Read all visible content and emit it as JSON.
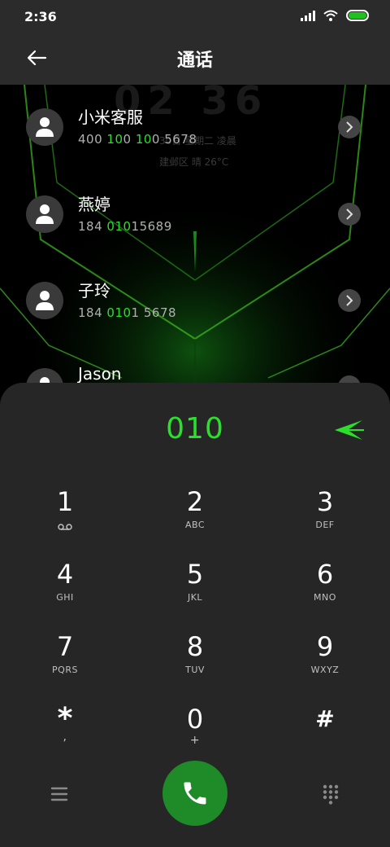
{
  "status_bar": {
    "time": "2:36",
    "battery_color": "#1ec21e"
  },
  "header": {
    "title": "通话",
    "back_icon": "arrow-left-icon"
  },
  "wallpaper": {
    "clock": "02 36",
    "date": "30日 星期二 凌晨",
    "weather": "建邺区 晴 26°C"
  },
  "contacts": [
    {
      "name": "小米客服",
      "num_pre": "400 ",
      "num_hl1": "10",
      "num_mid": "0 ",
      "num_hl2": "10",
      "num_post": "0 5678"
    },
    {
      "name": "燕婷",
      "num_pre": "184 ",
      "num_hl1": "010",
      "num_mid": "",
      "num_hl2": "",
      "num_post": "15689"
    },
    {
      "name": "子玲",
      "num_pre": "184 ",
      "num_hl1": "010",
      "num_mid": "",
      "num_hl2": "",
      "num_post": "1 5678"
    },
    {
      "name": "Jason",
      "num_pre": "",
      "num_hl1": "",
      "num_mid": "",
      "num_hl2": "",
      "num_post": ""
    }
  ],
  "dialer": {
    "digits": "010",
    "accent": "#2be02b",
    "keys": [
      {
        "num": "1",
        "letters": ""
      },
      {
        "num": "2",
        "letters": "ABC"
      },
      {
        "num": "3",
        "letters": "DEF"
      },
      {
        "num": "4",
        "letters": "GHI"
      },
      {
        "num": "5",
        "letters": "JKL"
      },
      {
        "num": "6",
        "letters": "MNO"
      },
      {
        "num": "7",
        "letters": "PQRS"
      },
      {
        "num": "8",
        "letters": "TUV"
      },
      {
        "num": "9",
        "letters": "WXYZ"
      },
      {
        "num": "*",
        "letters": ","
      },
      {
        "num": "0",
        "letters": "+"
      },
      {
        "num": "#",
        "letters": ""
      }
    ],
    "call_color": "#1e8a28"
  }
}
